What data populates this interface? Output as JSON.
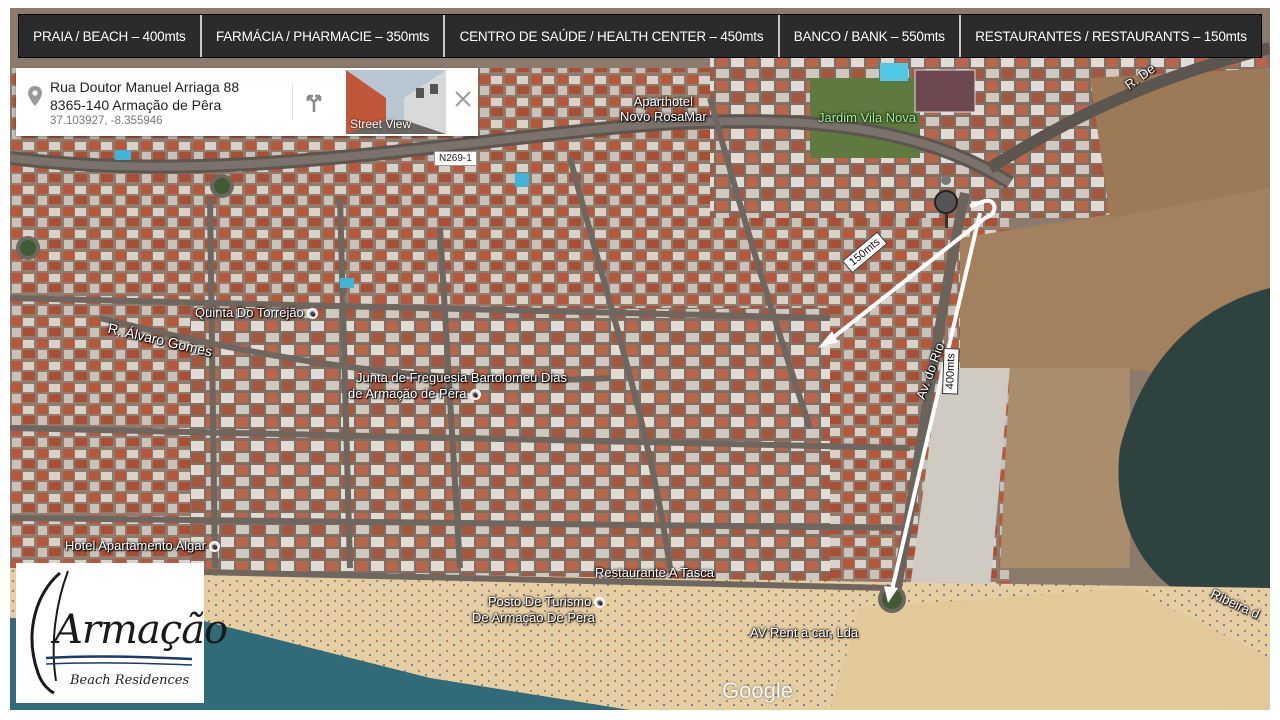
{
  "topbar": {
    "items": [
      {
        "label": "PRAIA / BEACH – 400mts"
      },
      {
        "label": "FARMÁCIA / PHARMACIE – 350mts"
      },
      {
        "label": "CENTRO DE SAÚDE / HEALTH CENTER – 450mts"
      },
      {
        "label": "BANCO / BANK –  550mts"
      },
      {
        "label": "RESTAURANTES / RESTAURANTS – 150mts"
      }
    ]
  },
  "card": {
    "address_line1": "Rua Doutor Manuel Arriaga 88",
    "address_line2": "8365-140 Armação de Pêra",
    "coordinates": "37.103927, -8.355946",
    "street_view_label": "Street View",
    "icons": {
      "pin": "location-pin-icon",
      "directions": "directions-icon",
      "close": "close-icon"
    }
  },
  "map": {
    "labels": {
      "aparthotel": "Aparthotel\nNovo RosaMar",
      "jardim": "Jardim Vila Nova",
      "road_n269": "N269-1",
      "quinta": "Quinta Do Torrejão",
      "alvaro": "R. Álvaro Gomes",
      "junta_1": "Junta de Freguesia Bartolomeu Dias",
      "junta_2": "de Armação de Pêra",
      "av_rio": "Av. do Rio",
      "hotel_algar": "Hotel Apartamento Algar",
      "restaurante": "Restaurante A Tasca",
      "posto_1": "Posto De Turismo",
      "posto_2": "De Armação De Pêra",
      "av_rent": "AV Rent a car, Lda",
      "ribeira": "Ribeira d",
      "rua_de": "R. De",
      "google": "Google"
    },
    "distances": {
      "restaurants": "150mts",
      "beach": "400mts"
    },
    "colors": {
      "arrow": "#ffffff",
      "beach_sand": "#e7cfa6",
      "sea": "#2f6b78",
      "roofs": "#b9654a"
    }
  },
  "logo": {
    "word": "Armação",
    "subtitle": "Beach Residences"
  }
}
